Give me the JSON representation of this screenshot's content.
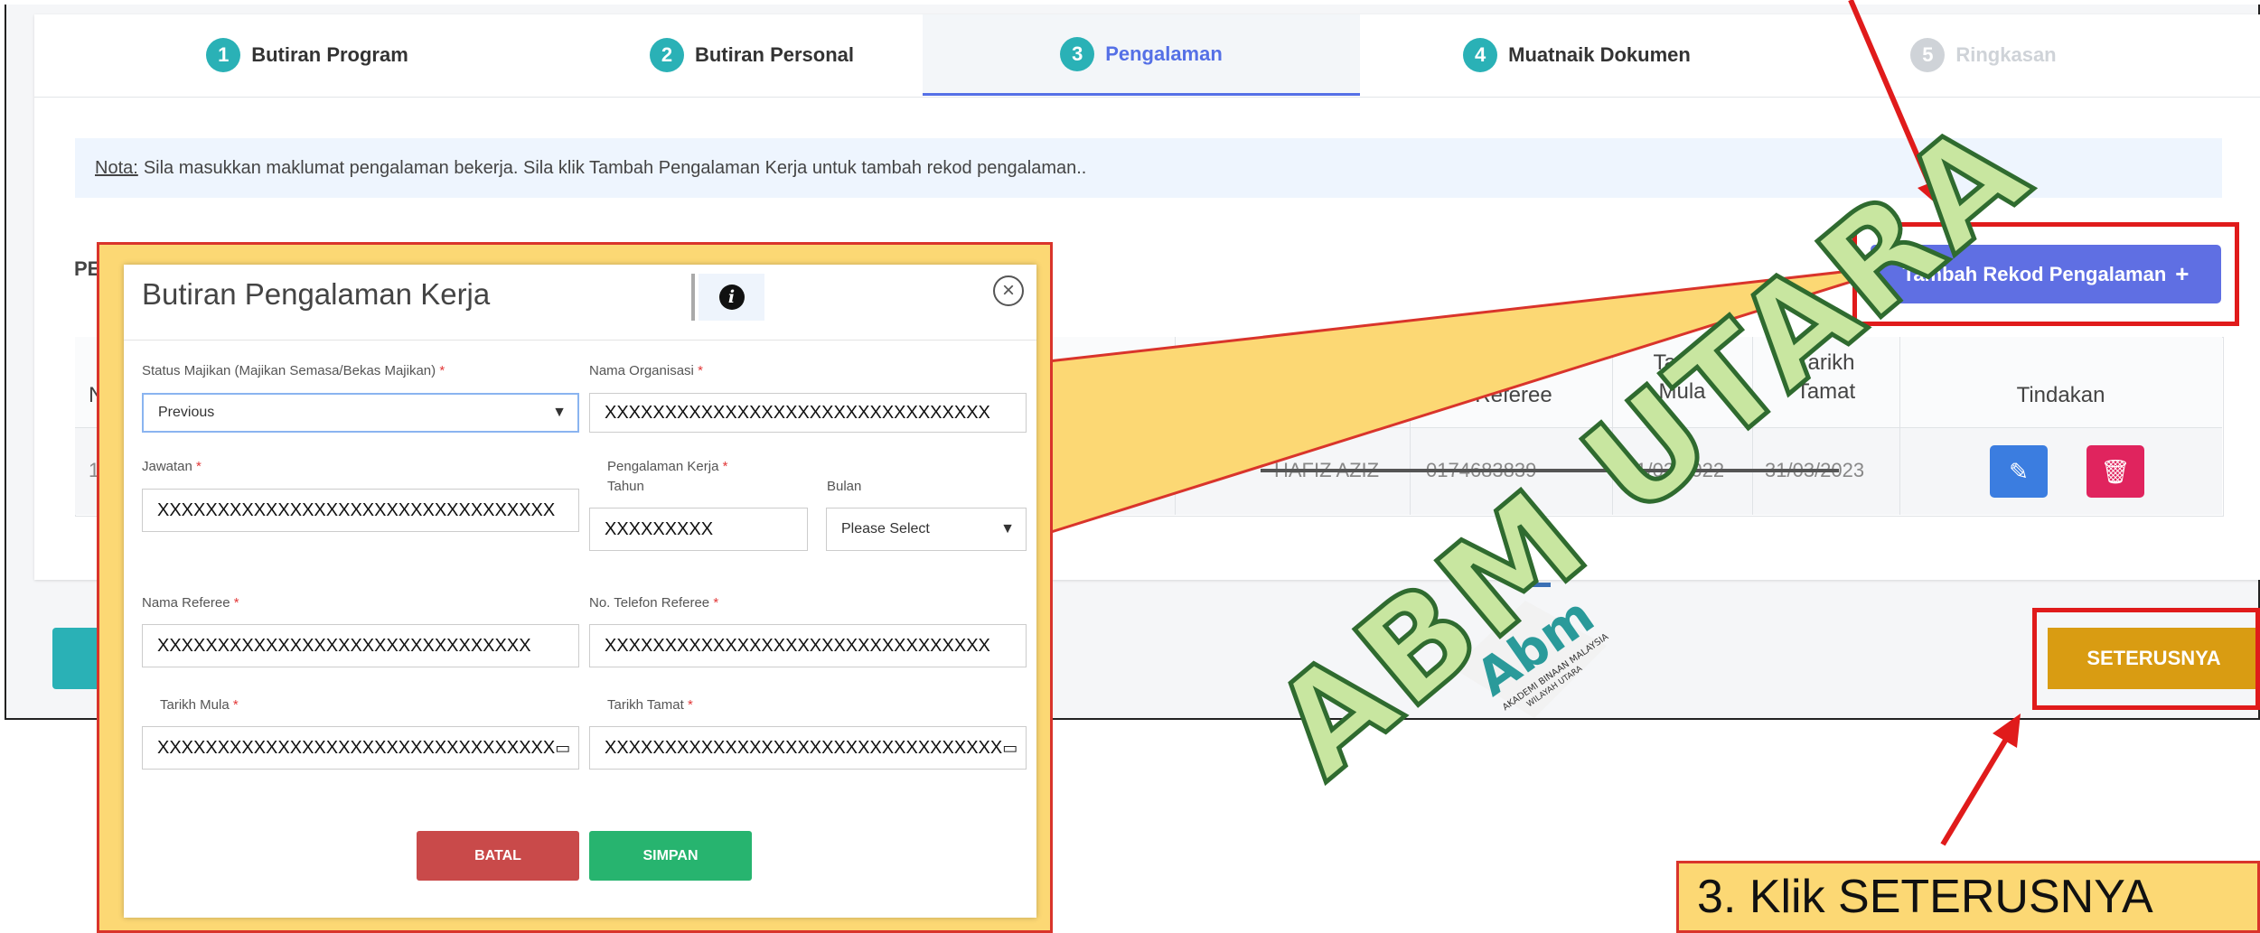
{
  "tabs": [
    {
      "num": "1",
      "label": "Butiran Program"
    },
    {
      "num": "2",
      "label": "Butiran Personal"
    },
    {
      "num": "3",
      "label": "Pengalaman"
    },
    {
      "num": "4",
      "label": "Muatnaik Dokumen"
    },
    {
      "num": "5",
      "label": "Ringkasan"
    }
  ],
  "nota": {
    "prefix": "Nota:",
    "text": "Sila masukkan maklumat pengalaman bekerja. Sila klik Tambah Pengalaman Kerja untuk tambah rekod pengalaman.."
  },
  "section_label": "PE",
  "table": {
    "headers": {
      "referee": "Referee",
      "tarikh_mula": "Tarikh\nMula",
      "tarikh_tamat": "Tarikh\nTamat",
      "tindakan": "Tindakan",
      "first": "N"
    },
    "row": {
      "no": "1",
      "referee_name": "HAFIZ AZIZ",
      "phone": "0174683839",
      "mula": "01/03/2022",
      "tamat": "31/03/2023"
    }
  },
  "tambah_button": "Tambah Rekod Pengalaman",
  "seterusnya_button": "SETERUSNYA",
  "instruction": "3. Klik SETERUSNYA",
  "watermark": "ABM UTARA",
  "logo": {
    "main": "Abm",
    "sub": "AKADEMI BINAAN MALAYSIA",
    "sub2": "WILAYAH UTARA"
  },
  "modal": {
    "title": "Butiran Pengalaman Kerja",
    "status_label": "Status Majikan (Majikan Semasa/Bekas Majikan)",
    "status_value": "Previous",
    "org_label": "Nama Organisasi",
    "org_value": "XXXXXXXXXXXXXXXXXXXXXXXXXXXXXXXX",
    "jawatan_label": "Jawatan",
    "jawatan_value": "XXXXXXXXXXXXXXXXXXXXXXXXXXXXXXXXX",
    "pengalaman_label": "Pengalaman Kerja",
    "tahun_label": "Tahun",
    "tahun_value": "XXXXXXXXX",
    "bulan_label": "Bulan",
    "bulan_value": "Please Select",
    "referee_label": "Nama Referee",
    "referee_value": "XXXXXXXXXXXXXXXXXXXXXXXXXXXXXXX",
    "telefon_label": "No. Telefon Referee",
    "telefon_value": "XXXXXXXXXXXXXXXXXXXXXXXXXXXXXXXX",
    "mula_label": "Tarikh Mula",
    "mula_value": "XXXXXXXXXXXXXXXXXXXXXXXXXXXXXXXXX",
    "tamat_label": "Tarikh Tamat",
    "tamat_value": "XXXXXXXXXXXXXXXXXXXXXXXXXXXXXXXXX",
    "batal": "BATAL",
    "simpan": "SIMPAN"
  }
}
